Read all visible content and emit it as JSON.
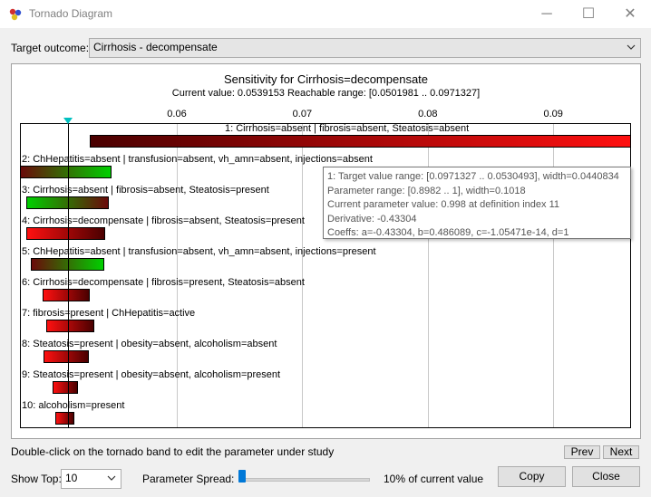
{
  "window": {
    "title": "Tornado Diagram",
    "minimize": "─",
    "maximize": "☐",
    "close": "✕"
  },
  "target": {
    "label": "Target outcome:",
    "value": "Cirrhosis - decompensate"
  },
  "chart_data": {
    "type": "tornado",
    "title": "Sensitivity for Cirrhosis=decompensate",
    "subtitle": "Current value: 0.0539153  Reachable range: [0.0501981 .. 0.0971327]",
    "current_value": 0.0539153,
    "x_ticks": [
      "0.06",
      "0.07",
      "0.08",
      "0.09"
    ],
    "x_tick_values": [
      0.06,
      0.07,
      0.08,
      0.09
    ],
    "xlim": [
      0.0475,
      0.0962
    ],
    "parameters": [
      {
        "label": "1: Cirrhosis=absent | fibrosis=absent, Steatosis=absent",
        "low": 0.0530493,
        "high": 0.0971327,
        "style": "hi"
      },
      {
        "label": "2: ChHepatitis=absent | transfusion=absent, vh_amn=absent, injections=absent",
        "low": 0.0475,
        "high": 0.0548,
        "style": "lohi"
      },
      {
        "label": "3: Cirrhosis=absent | fibrosis=absent, Steatosis=present",
        "low": 0.048,
        "high": 0.0546,
        "style": "lo"
      },
      {
        "label": "4: Cirrhosis=decompensate | fibrosis=absent, Steatosis=present",
        "low": 0.048,
        "high": 0.0543,
        "style": "hilo"
      },
      {
        "label": "5: ChHepatitis=absent | transfusion=absent, vh_amn=absent, injections=present",
        "low": 0.0484,
        "high": 0.0542,
        "style": "lohi"
      },
      {
        "label": "6: Cirrhosis=decompensate | fibrosis=present, Steatosis=absent",
        "low": 0.0493,
        "high": 0.0531,
        "style": "hilo"
      },
      {
        "label": "7: fibrosis=present | ChHepatitis=active",
        "low": 0.0496,
        "high": 0.0534,
        "style": "hilo"
      },
      {
        "label": "8: Steatosis=present | obesity=absent, alcoholism=absent",
        "low": 0.0494,
        "high": 0.053,
        "style": "hilo"
      },
      {
        "label": "9: Steatosis=present | obesity=absent, alcoholism=present",
        "low": 0.0501,
        "high": 0.0521,
        "style": "hilo"
      },
      {
        "label": "10: alcoholism=present",
        "low": 0.0503,
        "high": 0.0518,
        "style": "hilo"
      }
    ]
  },
  "tooltip": {
    "line1": "1: Target value range: [0.0971327 .. 0.0530493], width=0.0440834",
    "line2": "Parameter range: [0.8982 .. 1], width=0.1018",
    "line3": "Current parameter value: 0.998 at definition index 11",
    "line4": "Derivative: -0.43304",
    "line5": "Coeffs: a=-0.43304, b=0.486089, c=-1.05471e-14, d=1"
  },
  "hint": "Double-click on the tornado band to edit the parameter under study",
  "prev_label": "Prev",
  "next_label": "Next",
  "show_top": {
    "label": "Show Top:",
    "value": "10"
  },
  "spread": {
    "label": "Parameter Spread:",
    "value_text": "10% of current value",
    "level_percent": 10
  },
  "copy_label": "Copy",
  "close_label": "Close"
}
